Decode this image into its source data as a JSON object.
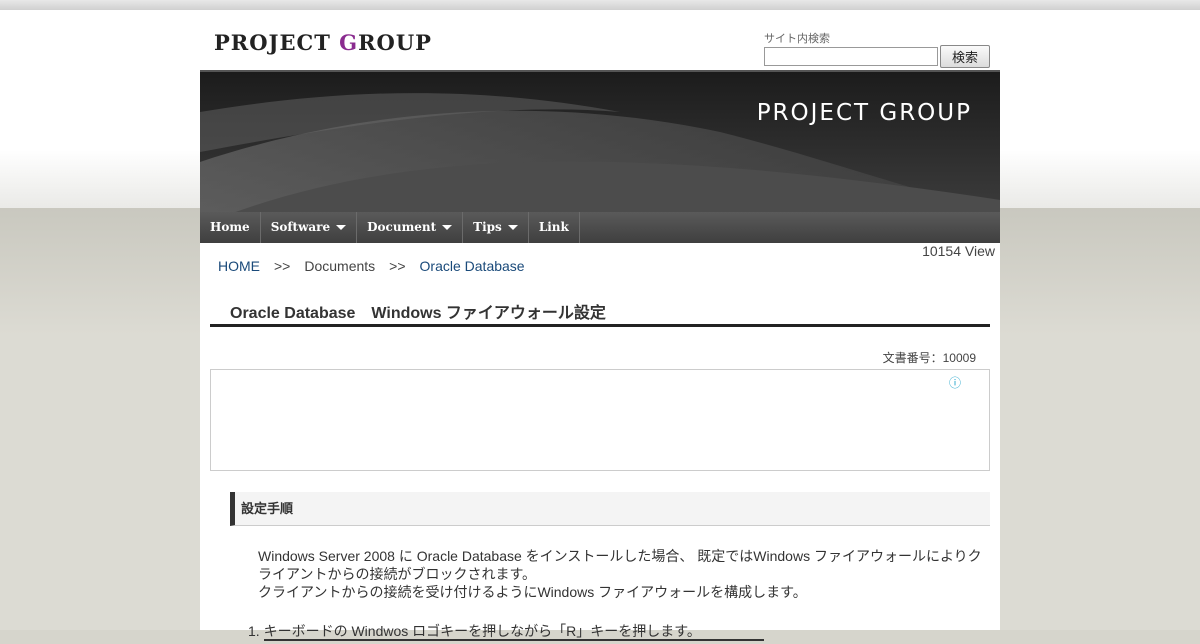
{
  "header": {
    "logo": {
      "text_main": "PROJECT ",
      "text_accent": "G",
      "text_rest": "ROUP"
    },
    "search": {
      "label": "サイト内検索",
      "placeholder": "",
      "button_label": "検索"
    },
    "banner_title": "PROJECT GROUP"
  },
  "nav": {
    "items": [
      {
        "label": "Home",
        "has_menu": false
      },
      {
        "label": "Software",
        "has_menu": true
      },
      {
        "label": "Document",
        "has_menu": true
      },
      {
        "label": "Tips",
        "has_menu": true
      },
      {
        "label": "Link",
        "has_menu": false
      }
    ]
  },
  "content": {
    "view_count": "10154 View",
    "breadcrumb": {
      "home": "HOME",
      "separator": ">>",
      "documents": "Documents",
      "current": "Oracle Database"
    },
    "page_title": "Oracle Database　Windows ファイアウォール設定",
    "doc_number": "文書番号：10009",
    "ad_info_icon": "info-icon",
    "section_heading": "設定手順",
    "paragraph_1": "Windows Server 2008 に Oracle Database をインストールした場合、 既定ではWindows ファイアウォールによりクライアントからの接続がブロックされます。",
    "paragraph_2": "クライアントからの接続を受け付けるようにWindows ファイアウォールを構成します。",
    "step_1": "1. キーボードの Windwos ロゴキーを押しながら「R」キーを押します。"
  },
  "colors": {
    "nav_bg": "#4a4a4a",
    "banner_bg": "#2b2b2b",
    "link": "#1a4a7a",
    "logo_accent": "#8a2b8f",
    "page_bg": "#d6d5cc"
  }
}
